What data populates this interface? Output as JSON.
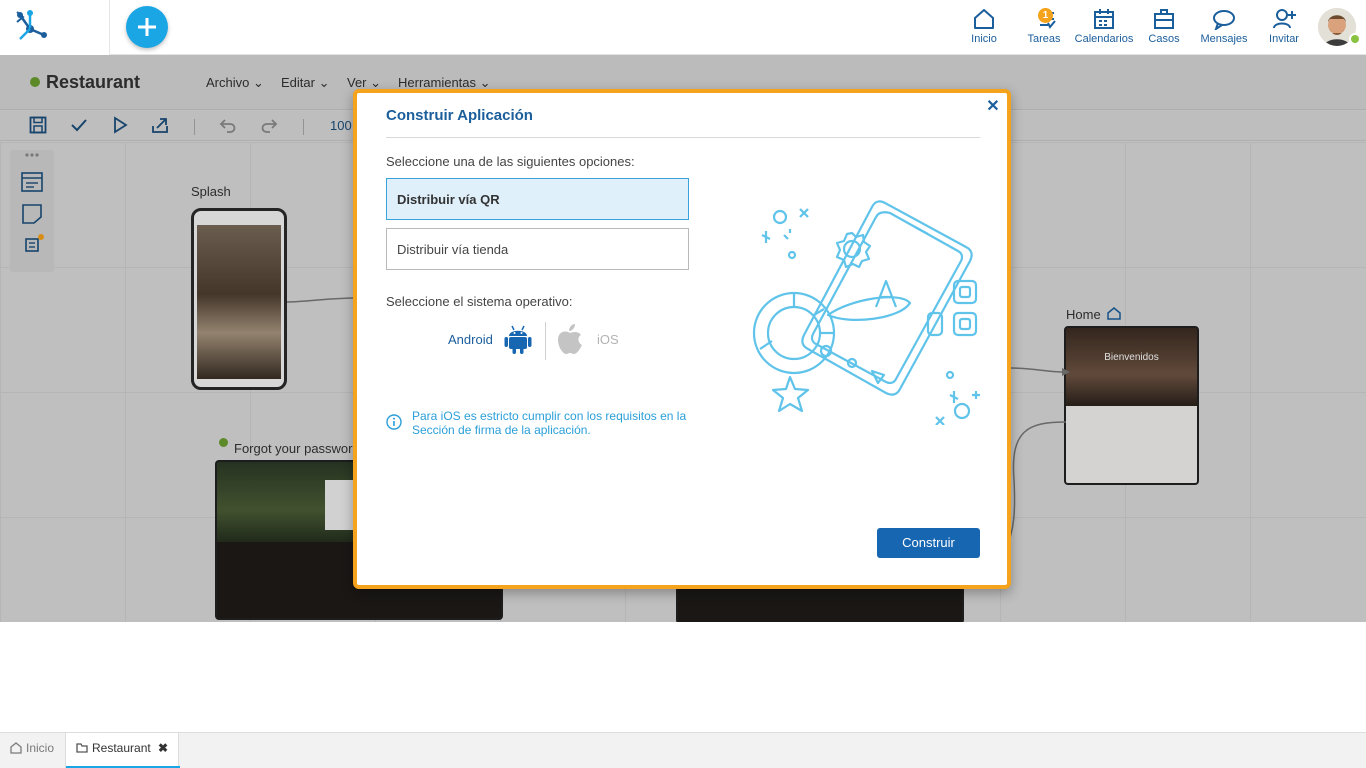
{
  "topbar": {
    "nav": [
      {
        "label": "Inicio",
        "icon": "home-icon"
      },
      {
        "label": "Tareas",
        "icon": "tasks-icon",
        "badge": "1"
      },
      {
        "label": "Calendarios",
        "icon": "calendar-icon"
      },
      {
        "label": "Casos",
        "icon": "briefcase-icon"
      },
      {
        "label": "Mensajes",
        "icon": "message-icon"
      },
      {
        "label": "Invitar",
        "icon": "invite-user-icon"
      }
    ],
    "accent": "#1aa6e4",
    "brand": "#1b5e9c"
  },
  "app": {
    "title": "Restaurant",
    "menus": [
      "Archivo",
      "Editar",
      "Ver",
      "Herramientas"
    ],
    "zoom": "100",
    "nodes": {
      "splash": "Splash",
      "forgot": "Forgot your passwor",
      "home": "Home",
      "home_welcome": "Bienvenidos"
    }
  },
  "modal": {
    "title": "Construir Aplicación",
    "prompt_options": "Seleccione una de las siguientes opciones:",
    "options": [
      {
        "label": "Distribuir vía QR",
        "selected": true
      },
      {
        "label": "Distribuir vía tienda",
        "selected": false
      }
    ],
    "prompt_os": "Seleccione el sistema operativo:",
    "os": {
      "android": "Android",
      "ios": "iOS",
      "selected": "android"
    },
    "info": "Para iOS es estricto cumplir con los requisitos en la Sección de firma de la aplicación.",
    "build_label": "Construir",
    "border_color": "#f5a21c"
  },
  "tabs": [
    {
      "label": "Inicio",
      "icon": "home-icon",
      "active": false
    },
    {
      "label": "Restaurant",
      "icon": "folder-icon",
      "active": true
    }
  ]
}
